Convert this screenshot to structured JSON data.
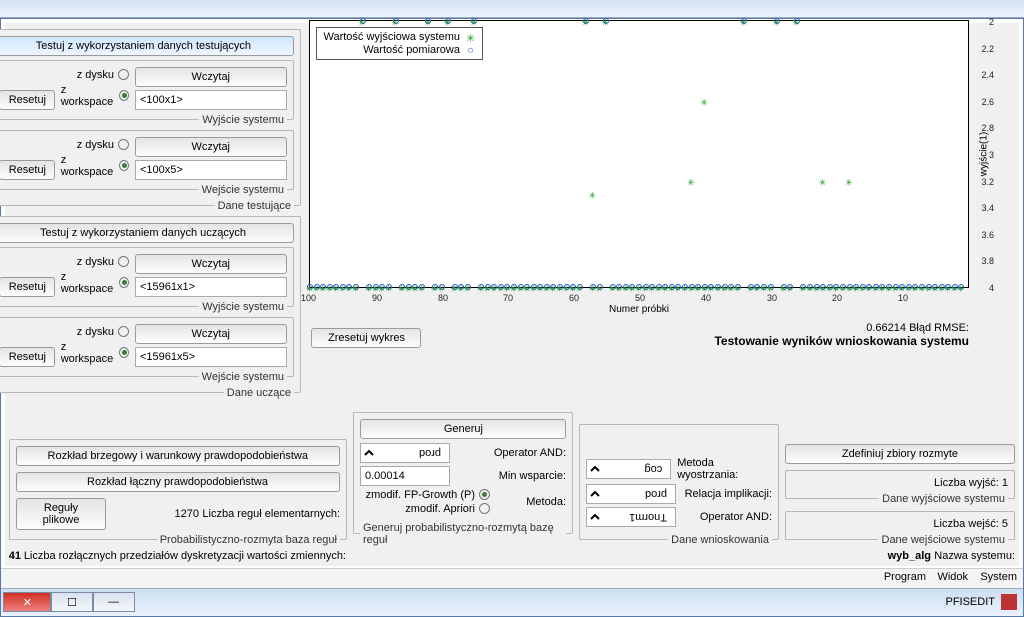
{
  "window": {
    "title": "PFISEDIT"
  },
  "menubar": [
    "System",
    "Widok",
    "Program"
  ],
  "header": {
    "name_label": "Nazwa systemu:",
    "name_value": "wyb_alg",
    "discr_label": "Liczba rozłącznych przedziałów dyskretyzacji wartości zmiennych:",
    "discr_value": "41"
  },
  "panel_input": {
    "legend": "Dane wejściowe systemu",
    "count_label": "Liczba wejść: 5"
  },
  "panel_output": {
    "legend": "Dane wyjściowe systemu",
    "count_label": "Liczba wyjść: 1"
  },
  "buttons": {
    "define_fuzzy": "Zdefiniuj zbiory rozmyte",
    "reset_plot": "Zresetuj wykres",
    "rules_file": "Reguły plikowe",
    "joint_dist": "Rozkład łączny prawdopodobieństwa",
    "marginal_dist": "Rozkład brzegowy i warunkowy prawdopodobieństwa",
    "generate": "Generuj",
    "load": "Wczytaj",
    "reset": "Resetuj",
    "test_learn": "Testuj z wykorzystaniem danych uczących",
    "test_test": "Testuj z wykorzystaniem danych testujących"
  },
  "inference": {
    "legend": "Dane wnioskowania",
    "and_label": "Operator AND:",
    "and_value": "Tnorm1",
    "impl_label": "Relacja implikacji:",
    "impl_value": "prod",
    "defuzz_label": "Metoda wyostrzania:",
    "defuzz_value": "cog"
  },
  "rulegen": {
    "legend": "Generuj probabilistyczno-rozmytą bazę reguł",
    "method_label": "Metoda:",
    "method_opt1": "zmodif. Apriori",
    "method_opt2": "zmodif. FP-Growth (P)",
    "minsupp_label": "Min wsparcie:",
    "minsupp_value": "0.00014",
    "and_label": "Operator AND:",
    "and_value": "prod"
  },
  "rulebase": {
    "legend": "Probabilistyczno-rozmyta baza reguł",
    "elem_label": "Liczba reguł elementarnych:",
    "elem_value": "1270"
  },
  "data_learn": {
    "legend": "Dane uczące",
    "in_legend": "Wejście systemu",
    "in_value": "<15961x5>",
    "out_legend": "Wyjście systemu",
    "out_value": "<15961x1>",
    "opt_workspace": "z workspace",
    "opt_disk": "z dysku"
  },
  "data_test": {
    "legend": "Dane testujące",
    "in_legend": "Wejście systemu",
    "in_value": "<100x5>",
    "out_legend": "Wyjście systemu",
    "out_value": "<100x1>",
    "opt_workspace": "z workspace",
    "opt_disk": "z dysku"
  },
  "plot": {
    "title": "Testowanie wyników wnioskowania systemu",
    "rmse_label": "Błąd RMSE:",
    "rmse_value": "0.66214",
    "xlabel": "Numer próbki",
    "ylabel": "wyjście(1)",
    "leg_meas": "Wartość pomiarowa",
    "leg_sys": "Wartość wyjściowa systemu"
  },
  "chart_data": {
    "type": "scatter",
    "title": "Testowanie wyników wnioskowania systemu",
    "xlabel": "Numer próbki",
    "ylabel": "wyjście(1)",
    "xlim": [
      0,
      100
    ],
    "ylim": [
      2,
      4
    ],
    "xticks": [
      10,
      20,
      30,
      40,
      50,
      60,
      70,
      80,
      90,
      100
    ],
    "yticks": [
      2,
      2.2,
      2.4,
      2.6,
      2.8,
      3,
      3.2,
      3.4,
      3.6,
      3.8,
      4
    ],
    "series": [
      {
        "name": "Wartość pomiarowa",
        "marker": "o",
        "x": [
          1,
          2,
          3,
          4,
          5,
          6,
          7,
          8,
          9,
          10,
          11,
          12,
          13,
          14,
          15,
          16,
          17,
          18,
          19,
          20,
          21,
          22,
          23,
          24,
          25,
          27,
          28,
          30,
          31,
          32,
          33,
          35,
          36,
          37,
          38,
          39,
          40,
          41,
          42,
          43,
          44,
          45,
          46,
          47,
          48,
          49,
          50,
          51,
          52,
          53,
          54,
          56,
          57,
          59,
          60,
          61,
          62,
          63,
          64,
          65,
          66,
          67,
          68,
          69,
          70,
          71,
          72,
          73,
          74,
          76,
          77,
          78,
          80,
          81,
          83,
          84,
          85,
          86,
          88,
          89,
          90,
          91,
          93,
          94,
          95,
          96,
          97,
          98,
          99,
          100,
          26,
          29,
          34,
          55,
          58,
          75,
          79,
          82,
          87,
          92
        ],
        "y": [
          4,
          4,
          4,
          4,
          4,
          4,
          4,
          4,
          4,
          4,
          4,
          4,
          4,
          4,
          4,
          4,
          4,
          4,
          4,
          4,
          4,
          4,
          4,
          4,
          4,
          4,
          4,
          4,
          4,
          4,
          4,
          4,
          4,
          4,
          4,
          4,
          4,
          4,
          4,
          4,
          4,
          4,
          4,
          4,
          4,
          4,
          4,
          4,
          4,
          4,
          4,
          4,
          4,
          4,
          4,
          4,
          4,
          4,
          4,
          4,
          4,
          4,
          4,
          4,
          4,
          4,
          4,
          4,
          4,
          4,
          4,
          4,
          4,
          4,
          4,
          4,
          4,
          4,
          4,
          4,
          4,
          4,
          4,
          4,
          4,
          4,
          4,
          4,
          4,
          4,
          2,
          2,
          2,
          2,
          2,
          2,
          2,
          2,
          2,
          2
        ]
      },
      {
        "name": "Wartość wyjściowa systemu",
        "marker": "*",
        "x": [
          1,
          2,
          3,
          4,
          5,
          6,
          7,
          8,
          9,
          10,
          11,
          12,
          13,
          14,
          15,
          16,
          17,
          18,
          19,
          20,
          21,
          22,
          23,
          24,
          25,
          27,
          28,
          30,
          31,
          32,
          33,
          35,
          36,
          37,
          38,
          39,
          40,
          41,
          42,
          43,
          44,
          45,
          46,
          47,
          48,
          49,
          50,
          51,
          52,
          53,
          54,
          56,
          57,
          59,
          60,
          61,
          62,
          63,
          64,
          65,
          66,
          67,
          68,
          69,
          70,
          71,
          72,
          73,
          74,
          76,
          77,
          78,
          80,
          81,
          83,
          84,
          85,
          86,
          88,
          89,
          90,
          91,
          93,
          94,
          95,
          96,
          97,
          98,
          99,
          100,
          26,
          29,
          34,
          55,
          58,
          75,
          79,
          82,
          87,
          92,
          22,
          40,
          42,
          18,
          57
        ],
        "y": [
          4,
          4,
          4,
          4,
          4,
          4,
          4,
          4,
          4,
          4,
          4,
          4,
          4,
          4,
          4,
          4,
          4,
          4,
          4,
          4,
          4,
          4,
          4,
          4,
          4,
          4,
          4,
          4,
          4,
          4,
          4,
          4,
          4,
          4,
          4,
          4,
          4,
          4,
          4,
          4,
          4,
          4,
          4,
          4,
          4,
          4,
          4,
          4,
          4,
          4,
          4,
          4,
          4,
          4,
          4,
          4,
          4,
          4,
          4,
          4,
          4,
          4,
          4,
          4,
          4,
          4,
          4,
          4,
          4,
          4,
          4,
          4,
          4,
          4,
          4,
          4,
          4,
          4,
          4,
          4,
          4,
          4,
          4,
          4,
          4,
          4,
          4,
          4,
          4,
          4,
          2,
          2,
          2,
          2,
          2,
          2,
          2,
          2,
          2,
          2,
          3.2,
          2.6,
          3.2,
          3.2,
          3.3
        ]
      }
    ],
    "legend_position": "lower right",
    "rmse": 0.66214
  }
}
